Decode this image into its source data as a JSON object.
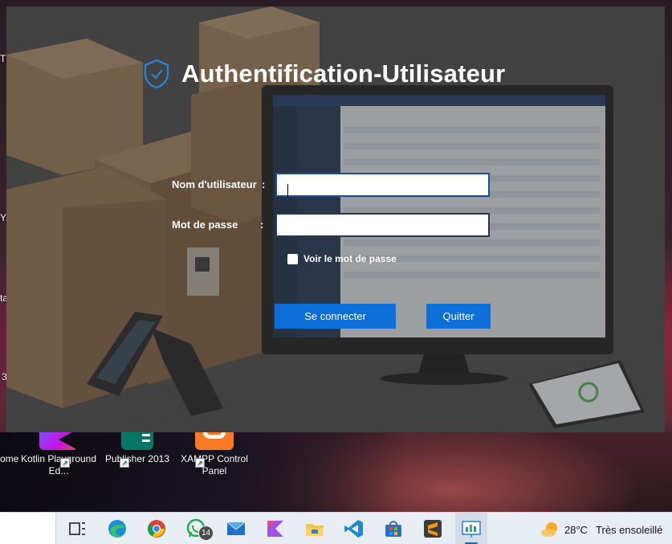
{
  "desktop": {
    "edge_texts": [
      "TS",
      "Y.",
      "ta",
      "3"
    ],
    "icons": [
      {
        "label": "ome",
        "icon": "chrome-shortcut-icon"
      },
      {
        "label": "Kotlin Playground  Ed...",
        "icon": "kotlin-icon"
      },
      {
        "label": "Publisher 2013",
        "icon": "publisher-icon"
      },
      {
        "label": "XAMPP Control Panel",
        "icon": "xampp-icon"
      }
    ]
  },
  "login": {
    "title": "Authentification-Utilisateur",
    "username_label": "Nom d'utilisateur",
    "password_label": "Mot de passe",
    "colon": ":",
    "username_value": "",
    "password_value": "",
    "show_password_label": "Voir le mot de passe",
    "show_password_checked": false,
    "connect_button": "Se connecter",
    "quit_button": "Quitter"
  },
  "taskbar": {
    "apps": [
      "task-view",
      "edge",
      "chrome",
      "whatsapp",
      "mail",
      "kotlin",
      "file-explorer",
      "vscode",
      "store",
      "sublime",
      "active-app"
    ],
    "whatsapp_badge": "14",
    "weather_temp": "28°C",
    "weather_text": "Très ensoleillé"
  },
  "colors": {
    "button": "#0f6fd8",
    "input_border": "#1f4c96",
    "taskbar": "#e9eef4"
  }
}
